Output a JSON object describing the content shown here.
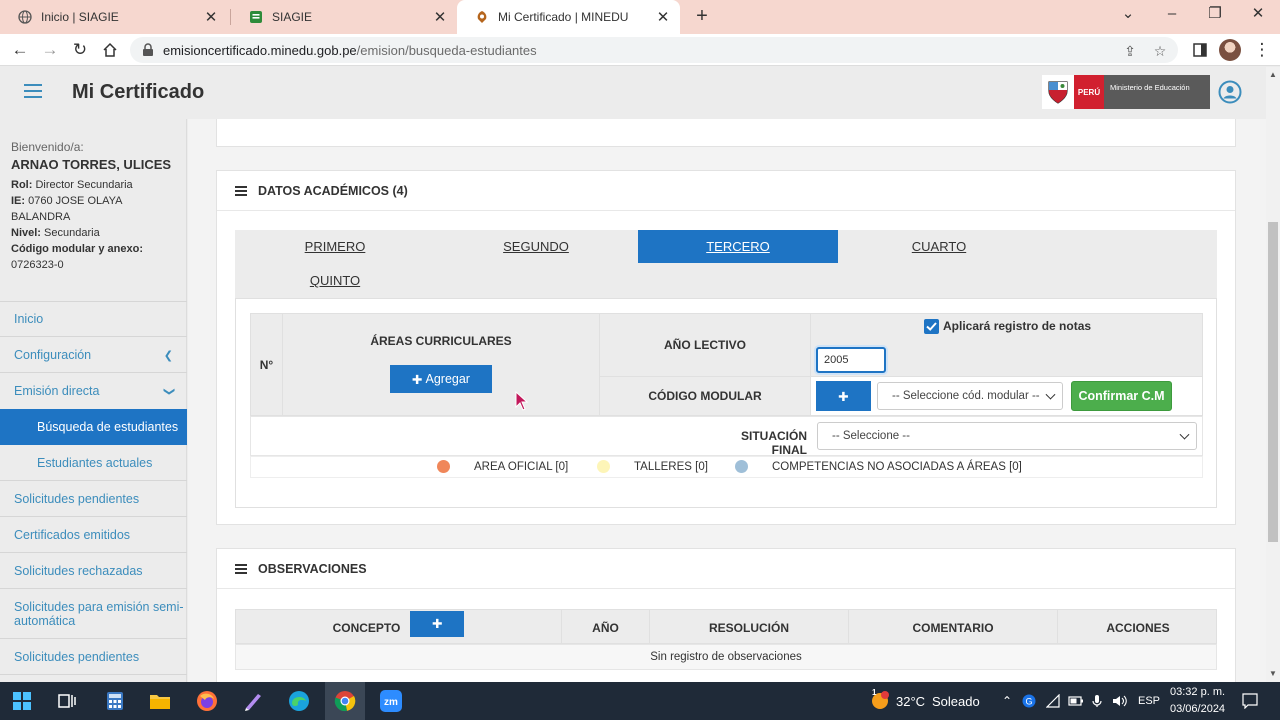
{
  "browser": {
    "tabs": [
      {
        "title": "Inicio | SIAGIE",
        "active": false
      },
      {
        "title": "SIAGIE",
        "active": false
      },
      {
        "title": "Mi Certificado | MINEDU",
        "active": true
      }
    ],
    "url_host": "emisioncertificado.minedu.gob.pe",
    "url_path": "/emision/busqueda-estudiantes"
  },
  "header": {
    "title": "Mi Certificado",
    "logo_country": "PERÚ",
    "logo_ministry": "Ministerio de Educación"
  },
  "sidebar": {
    "welcome": "Bienvenido/a:",
    "user_name": "ARNAO TORRES, ULICES",
    "rol_label": "Rol:",
    "rol_value": "Director Secundaria",
    "ie_label": "IE:",
    "ie_value": "0760 JOSE OLAYA BALANDRA",
    "nivel_label": "Nivel:",
    "nivel_value": "Secundaria",
    "codigo_label": "Código modular y anexo:",
    "codigo_value": "0726323-0",
    "items": [
      {
        "label": "Inicio"
      },
      {
        "label": "Configuración"
      },
      {
        "label": "Emisión directa"
      },
      {
        "label": "Búsqueda de estudiantes"
      },
      {
        "label": "Estudiantes actuales"
      },
      {
        "label": "Solicitudes pendientes"
      },
      {
        "label": "Certificados emitidos"
      },
      {
        "label": "Solicitudes rechazadas"
      },
      {
        "label": "Solicitudes para emisión semi-automática"
      },
      {
        "label": "Solicitudes pendientes"
      }
    ]
  },
  "academic": {
    "title": "DATOS ACADÉMICOS (4)",
    "tabs": [
      {
        "label": "PRIMERO"
      },
      {
        "label": "SEGUNDO"
      },
      {
        "label": "TERCERO"
      },
      {
        "label": "CUARTO"
      },
      {
        "label": "QUINTO"
      }
    ],
    "active_tab": "TERCERO",
    "col_num": "N°",
    "col_areas": "ÁREAS CURRICULARES",
    "add_button": "Agregar",
    "anio_lectivo_label": "AÑO LECTIVO",
    "anio_lectivo_value": "2005",
    "aplicara_label": "Aplicará registro de notas",
    "aplicara_checked": true,
    "codigo_modular_label": "CÓDIGO MODULAR",
    "codigo_modular_select": "-- Seleccione cód. modular --",
    "confirm_button": "Confirmar C.M",
    "situacion_label": "SITUACIÓN FINAL",
    "situacion_select": "-- Seleccione --",
    "legend": [
      {
        "label": "AREA OFICIAL [0]",
        "color": "#f0875a"
      },
      {
        "label": "TALLERES [0]",
        "color": "#fdf5b8"
      },
      {
        "label": "COMPETENCIAS NO ASOCIADAS A ÁREAS [0]",
        "color": "#9fbfd8"
      }
    ]
  },
  "observaciones": {
    "title": "OBSERVACIONES",
    "columns": [
      "CONCEPTO",
      "AÑO",
      "RESOLUCIÓN",
      "COMENTARIO",
      "ACCIONES"
    ],
    "empty_text": "Sin registro de observaciones"
  },
  "taskbar": {
    "temperature": "32°C",
    "weather": "Soleado",
    "language": "ESP",
    "time": "03:32 p. m.",
    "date": "03/06/2024",
    "weather_badge": "1"
  },
  "colors": {
    "primary": "#1e74c4",
    "success": "#4cae4c",
    "link": "#3c8dbc"
  }
}
